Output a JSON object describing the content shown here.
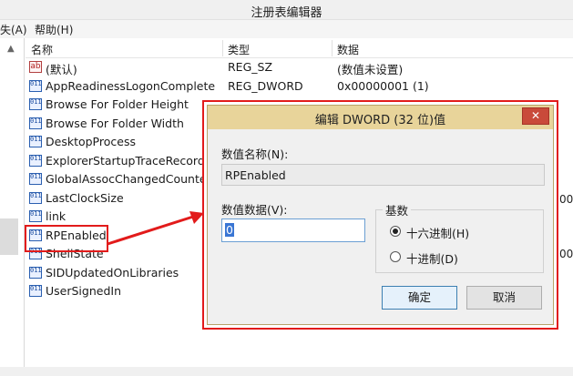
{
  "window": {
    "title": "注册表编辑器"
  },
  "menu": {
    "items": [
      "失(A)",
      "帮助(H)"
    ]
  },
  "columns": {
    "name": "名称",
    "type": "类型",
    "data": "数据"
  },
  "rows": [
    {
      "icon": "string-value-icon",
      "name": "(默认)",
      "type": "REG_SZ",
      "data": "(数值未设置)"
    },
    {
      "icon": "binary-value-icon",
      "name": "AppReadinessLogonComplete",
      "type": "REG_DWORD",
      "data": "0x00000001 (1)"
    },
    {
      "icon": "binary-value-icon",
      "name": "Browse For Folder Height",
      "type": "",
      "data": ""
    },
    {
      "icon": "binary-value-icon",
      "name": "Browse For Folder Width",
      "type": "",
      "data": ""
    },
    {
      "icon": "binary-value-icon",
      "name": "DesktopProcess",
      "type": "",
      "data": ""
    },
    {
      "icon": "binary-value-icon",
      "name": "ExplorerStartupTraceRecordec",
      "type": "",
      "data": ""
    },
    {
      "icon": "binary-value-icon",
      "name": "GlobalAssocChangedCounter",
      "type": "",
      "data": ""
    },
    {
      "icon": "binary-value-icon",
      "name": "LastClockSize",
      "type": "",
      "data": ""
    },
    {
      "icon": "binary-value-icon",
      "name": "link",
      "type": "",
      "data": ""
    },
    {
      "icon": "binary-value-icon",
      "name": "RPEnabled",
      "type": "",
      "data": ""
    },
    {
      "icon": "binary-value-icon",
      "name": "ShellState",
      "type": "",
      "data": ""
    },
    {
      "icon": "binary-value-icon",
      "name": "SIDUpdatedOnLibraries",
      "type": "",
      "data": ""
    },
    {
      "icon": "binary-value-icon",
      "name": "UserSignedIn",
      "type": "",
      "data": ""
    }
  ],
  "clipped": {
    "right_a": "00",
    "right_b": "00"
  },
  "dialog": {
    "title": "编辑 DWORD (32 位)值",
    "close_label": "✕",
    "name_label": "数值名称(N):",
    "name_value": "RPEnabled",
    "data_label": "数值数据(V):",
    "data_value": "0",
    "base_label": "基数",
    "radio_hex": "十六进制(H)",
    "radio_dec": "十进制(D)",
    "selected_base": "hex",
    "ok_label": "确定",
    "cancel_label": "取消"
  },
  "colors": {
    "highlight": "#e21b1b",
    "dialog_title": "#e8d49a",
    "close_button": "#c94a3a"
  }
}
